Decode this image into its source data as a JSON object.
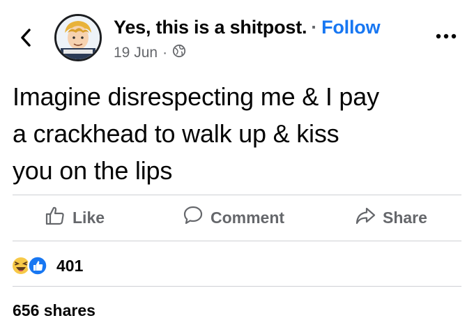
{
  "post": {
    "page_name": "Yes, this is a shitpost.",
    "separator": "·",
    "follow_label": "Follow",
    "date": "19 Jun",
    "privacy_icon": "globe-icon",
    "text_lines": [
      "Imagine disrespecting me & I pay",
      "a crackhead to walk up & kiss",
      "you on the lips"
    ]
  },
  "actions": {
    "like_label": "Like",
    "comment_label": "Comment",
    "share_label": "Share"
  },
  "reactions": {
    "icons": [
      "haha-emoji-icon",
      "like-thumb-icon"
    ],
    "count": "401"
  },
  "shares": {
    "label": "656 shares"
  },
  "colors": {
    "accent": "#1877f2",
    "secondary_text": "#65676b",
    "primary_text": "#050505",
    "divider": "#ced0d4"
  }
}
